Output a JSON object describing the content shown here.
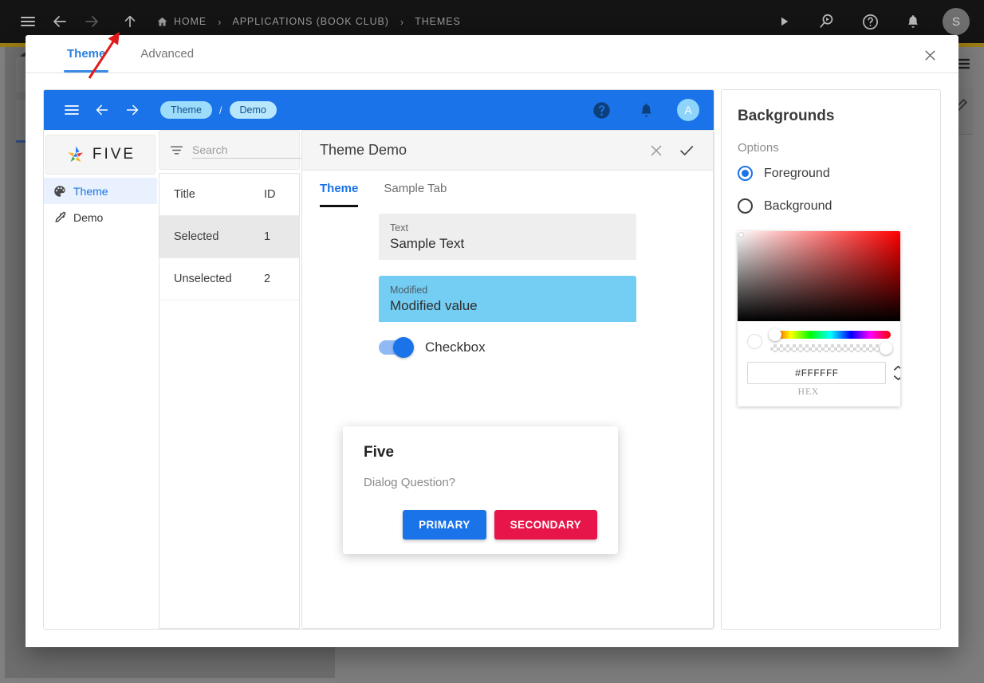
{
  "topbar": {
    "menu_icon": "hamburger-icon",
    "back_icon": "arrow-left-icon",
    "forward_icon": "arrow-right-icon",
    "up_icon": "arrow-up-icon",
    "home_icon": "home-icon",
    "breadcrumbs": [
      {
        "label": "HOME"
      },
      {
        "label": "APPLICATIONS (BOOK CLUB)"
      },
      {
        "label": "THEMES"
      }
    ],
    "separator": "›",
    "actions": [
      {
        "icon": "play-icon"
      },
      {
        "icon": "search-run-icon"
      },
      {
        "icon": "help-icon"
      },
      {
        "icon": "bell-icon"
      }
    ],
    "avatar_initial": "S"
  },
  "modal": {
    "tabs": [
      {
        "label": "Theme",
        "active": true
      },
      {
        "label": "Advanced",
        "active": false
      }
    ],
    "close_label": "✕"
  },
  "preview": {
    "appbar": {
      "menu_icon": "hamburger-icon",
      "back_icon": "arrow-left-icon",
      "forward_icon": "arrow-right-icon",
      "crumb_one": "Theme",
      "crumb_sep": "/",
      "crumb_two": "Demo",
      "help_icon": "help-icon",
      "bell_icon": "bell-icon",
      "avatar_initial": "A"
    },
    "nav": {
      "logo_text": "FIVE",
      "items": [
        {
          "label": "Theme",
          "icon": "palette-icon",
          "active": true
        },
        {
          "label": "Demo",
          "icon": "eyedropper-icon",
          "active": false
        }
      ]
    },
    "list": {
      "filter_icon": "filter-icon",
      "search_placeholder": "Search",
      "search_value": "",
      "search_icon": "search-icon",
      "columns": [
        "Title",
        "ID"
      ],
      "rows": [
        {
          "title": "Selected",
          "id": "1",
          "selected": true
        },
        {
          "title": "Unselected",
          "id": "2",
          "selected": false
        }
      ]
    },
    "form": {
      "title": "Theme Demo",
      "cancel_icon": "close-icon",
      "confirm_icon": "check-icon",
      "tabs": [
        {
          "label": "Theme",
          "active": true
        },
        {
          "label": "Sample Tab",
          "active": false
        }
      ],
      "fields": [
        {
          "label": "Text",
          "value": "Sample Text",
          "modified": false
        },
        {
          "label": "Modified",
          "value": "Modified value",
          "modified": true
        }
      ],
      "checkbox_label": "Checkbox",
      "checkbox_on": true
    },
    "dialog": {
      "title": "Five",
      "question": "Dialog Question?",
      "primary_button": "PRIMARY",
      "secondary_button": "SECONDARY"
    }
  },
  "sidepanel": {
    "title": "Backgrounds",
    "options_label": "Options",
    "options": [
      {
        "label": "Foreground",
        "selected": true
      },
      {
        "label": "Background",
        "selected": false
      }
    ],
    "picker": {
      "hex_value": "#FFFFFF",
      "hex_caption": "HEX",
      "spinner_icon": "spinner-updown-icon"
    }
  },
  "colors": {
    "accent_blue": "#1a73e8",
    "tab_blue": "#2a7fe0",
    "modified_cyan": "#74cdf2",
    "secondary_pink": "#e8154a",
    "chip_blue": "#9ddcfb",
    "topbar_black": "#141414",
    "gold_strip": "#9a7d16",
    "annotation_red": "#e01b1b"
  }
}
